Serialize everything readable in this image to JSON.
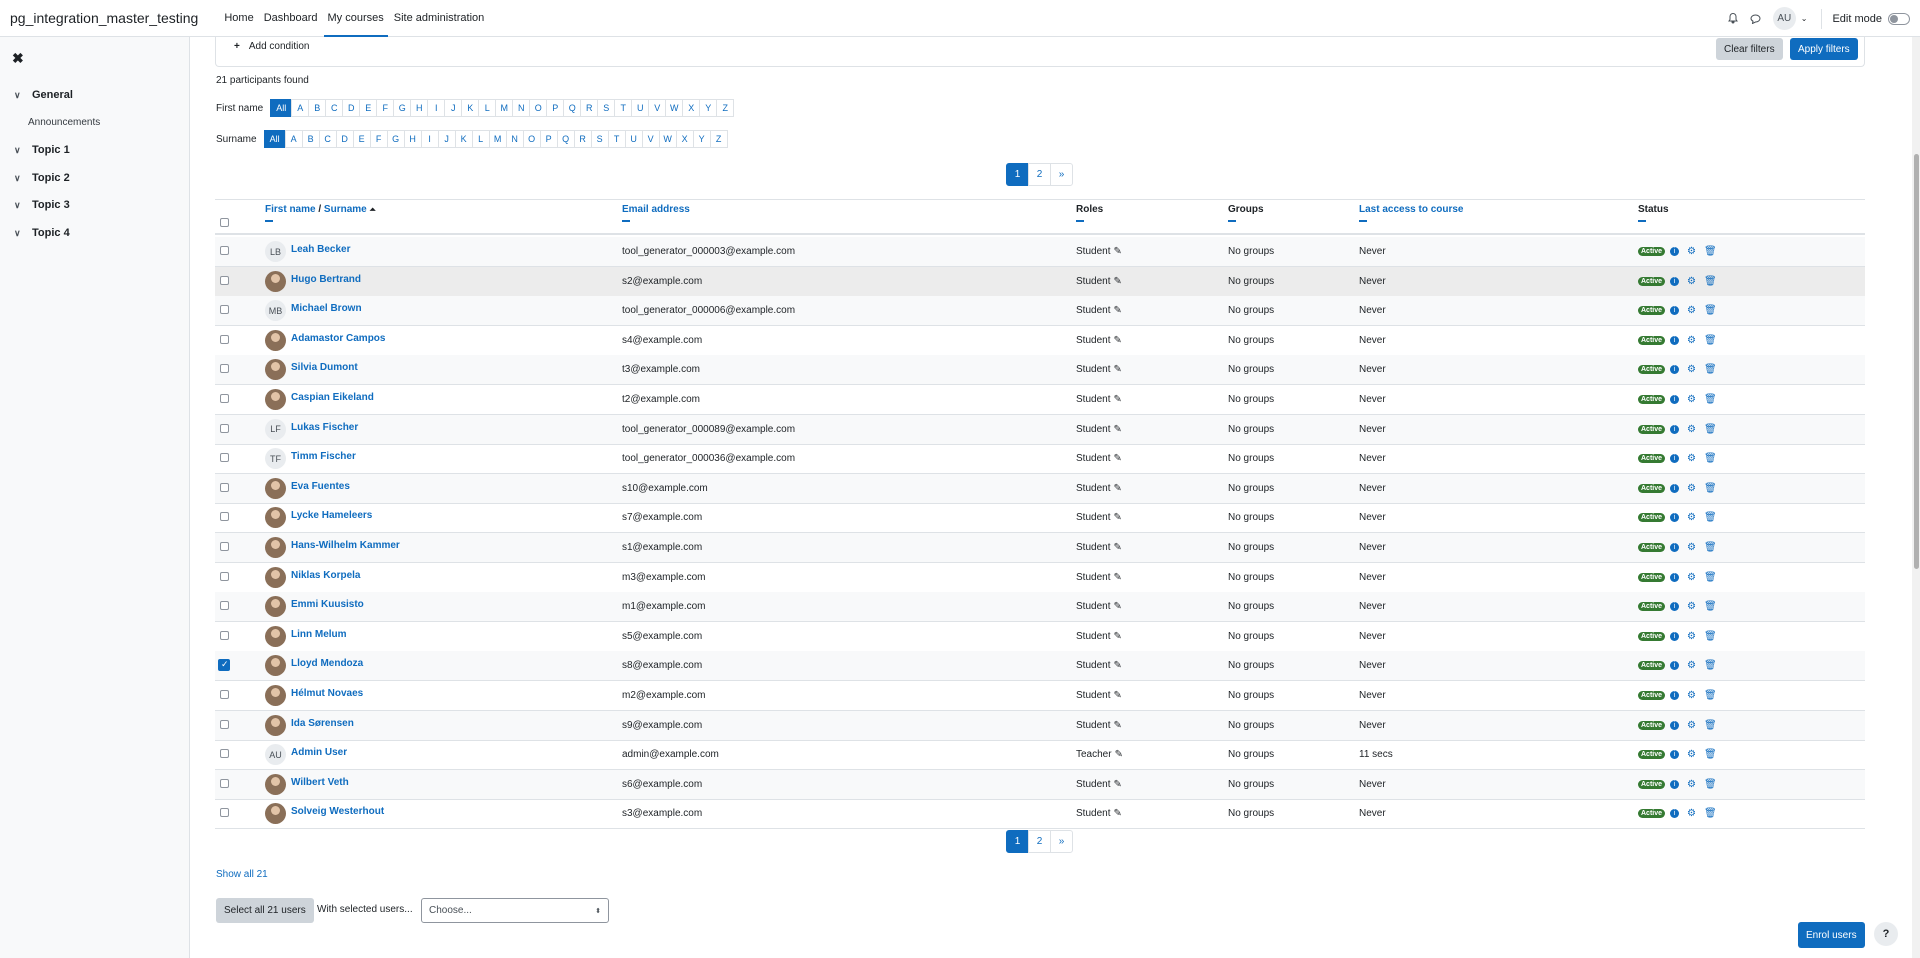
{
  "header": {
    "site_name": "pg_integration_master_testing",
    "nav": [
      "Home",
      "Dashboard",
      "My courses",
      "Site administration"
    ],
    "user_initials": "AU",
    "edit_mode_label": "Edit mode"
  },
  "drawer": {
    "sections": [
      {
        "label": "General",
        "items": [
          "Announcements"
        ]
      },
      {
        "label": "Topic 1"
      },
      {
        "label": "Topic 2"
      },
      {
        "label": "Topic 3"
      },
      {
        "label": "Topic 4"
      }
    ]
  },
  "filters": {
    "add_condition": "Add condition",
    "clear": "Clear filters",
    "apply": "Apply filters"
  },
  "participants_found": "21 participants found",
  "initials_bar": {
    "firstname_label": "First name",
    "surname_label": "Surname",
    "letters": [
      "All",
      "A",
      "B",
      "C",
      "D",
      "E",
      "F",
      "G",
      "H",
      "I",
      "J",
      "K",
      "L",
      "M",
      "N",
      "O",
      "P",
      "Q",
      "R",
      "S",
      "T",
      "U",
      "V",
      "W",
      "X",
      "Y",
      "Z"
    ],
    "selected": "All"
  },
  "pagination": {
    "pages": [
      "1",
      "2",
      "»"
    ],
    "current": "1"
  },
  "table": {
    "columns": {
      "first_name": "First name",
      "separator": "/",
      "surname": "Surname",
      "sort_arrow": "⏶",
      "email": "Email address",
      "roles": "Roles",
      "groups": "Groups",
      "last_access": "Last access to course",
      "status": "Status"
    },
    "rows": [
      {
        "initials": "LB",
        "name": "Leah Becker",
        "email": "tool_generator_000003@example.com",
        "role": "Student",
        "groups": "No groups",
        "last_access": "Never",
        "status": "Active",
        "checked": false
      },
      {
        "initials": "",
        "name": "Hugo Bertrand",
        "email": "s2@example.com",
        "role": "Student",
        "groups": "No groups",
        "last_access": "Never",
        "status": "Active",
        "checked": false
      },
      {
        "initials": "MB",
        "name": "Michael Brown",
        "email": "tool_generator_000006@example.com",
        "role": "Student",
        "groups": "No groups",
        "last_access": "Never",
        "status": "Active",
        "checked": false
      },
      {
        "initials": "",
        "name": "Adamastor Campos",
        "email": "s4@example.com",
        "role": "Student",
        "groups": "No groups",
        "last_access": "Never",
        "status": "Active",
        "checked": false
      },
      {
        "initials": "",
        "name": "Silvia Dumont",
        "email": "t3@example.com",
        "role": "Student",
        "groups": "No groups",
        "last_access": "Never",
        "status": "Active",
        "checked": false
      },
      {
        "initials": "",
        "name": "Caspian Eikeland",
        "email": "t2@example.com",
        "role": "Student",
        "groups": "No groups",
        "last_access": "Never",
        "status": "Active",
        "checked": false
      },
      {
        "initials": "LF",
        "name": "Lukas Fischer",
        "email": "tool_generator_000089@example.com",
        "role": "Student",
        "groups": "No groups",
        "last_access": "Never",
        "status": "Active",
        "checked": false
      },
      {
        "initials": "TF",
        "name": "Timm Fischer",
        "email": "tool_generator_000036@example.com",
        "role": "Student",
        "groups": "No groups",
        "last_access": "Never",
        "status": "Active",
        "checked": false
      },
      {
        "initials": "",
        "name": "Eva Fuentes",
        "email": "s10@example.com",
        "role": "Student",
        "groups": "No groups",
        "last_access": "Never",
        "status": "Active",
        "checked": false
      },
      {
        "initials": "",
        "name": "Lycke Hameleers",
        "email": "s7@example.com",
        "role": "Student",
        "groups": "No groups",
        "last_access": "Never",
        "status": "Active",
        "checked": false
      },
      {
        "initials": "",
        "name": "Hans-Wilhelm Kammer",
        "email": "s1@example.com",
        "role": "Student",
        "groups": "No groups",
        "last_access": "Never",
        "status": "Active",
        "checked": false
      },
      {
        "initials": "",
        "name": "Niklas Korpela",
        "email": "m3@example.com",
        "role": "Student",
        "groups": "No groups",
        "last_access": "Never",
        "status": "Active",
        "checked": false
      },
      {
        "initials": "",
        "name": "Emmi Kuusisto",
        "email": "m1@example.com",
        "role": "Student",
        "groups": "No groups",
        "last_access": "Never",
        "status": "Active",
        "checked": false
      },
      {
        "initials": "",
        "name": "Linn Melum",
        "email": "s5@example.com",
        "role": "Student",
        "groups": "No groups",
        "last_access": "Never",
        "status": "Active",
        "checked": false
      },
      {
        "initials": "",
        "name": "Lloyd Mendoza",
        "email": "s8@example.com",
        "role": "Student",
        "groups": "No groups",
        "last_access": "Never",
        "status": "Active",
        "checked": true
      },
      {
        "initials": "",
        "name": "Hélmut Novaes",
        "email": "m2@example.com",
        "role": "Student",
        "groups": "No groups",
        "last_access": "Never",
        "status": "Active",
        "checked": false
      },
      {
        "initials": "",
        "name": "Ida Sørensen",
        "email": "s9@example.com",
        "role": "Student",
        "groups": "No groups",
        "last_access": "Never",
        "status": "Active",
        "checked": false
      },
      {
        "initials": "AU",
        "name": "Admin User",
        "email": "admin@example.com",
        "role": "Teacher",
        "groups": "No groups",
        "last_access": "11 secs",
        "status": "Active",
        "checked": false
      },
      {
        "initials": "",
        "name": "Wilbert Veth",
        "email": "s6@example.com",
        "role": "Student",
        "groups": "No groups",
        "last_access": "Never",
        "status": "Active",
        "checked": false
      },
      {
        "initials": "",
        "name": "Solveig Westerhout",
        "email": "s3@example.com",
        "role": "Student",
        "groups": "No groups",
        "last_access": "Never",
        "status": "Active",
        "checked": false
      }
    ]
  },
  "footer": {
    "show_all": "Show all 21",
    "select_all": "Select all 21 users",
    "with_selected": "With selected users...",
    "choose": "Choose...",
    "enrol": "Enrol users",
    "help": "?"
  },
  "colors": {
    "accent": "#0f6cbf",
    "active_badge": "#357a32"
  }
}
